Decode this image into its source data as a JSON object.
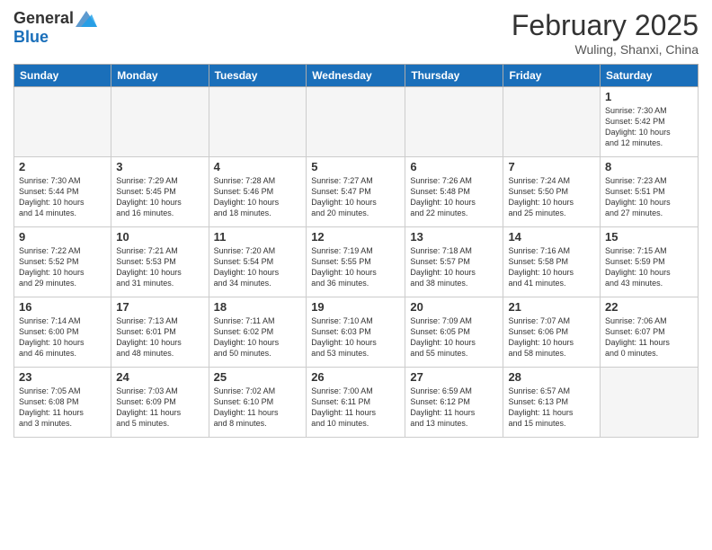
{
  "header": {
    "logo_general": "General",
    "logo_blue": "Blue",
    "month_title": "February 2025",
    "subtitle": "Wuling, Shanxi, China"
  },
  "days_of_week": [
    "Sunday",
    "Monday",
    "Tuesday",
    "Wednesday",
    "Thursday",
    "Friday",
    "Saturday"
  ],
  "weeks": [
    [
      {
        "num": "",
        "info": ""
      },
      {
        "num": "",
        "info": ""
      },
      {
        "num": "",
        "info": ""
      },
      {
        "num": "",
        "info": ""
      },
      {
        "num": "",
        "info": ""
      },
      {
        "num": "",
        "info": ""
      },
      {
        "num": "1",
        "info": "Sunrise: 7:30 AM\nSunset: 5:42 PM\nDaylight: 10 hours\nand 12 minutes."
      }
    ],
    [
      {
        "num": "2",
        "info": "Sunrise: 7:30 AM\nSunset: 5:44 PM\nDaylight: 10 hours\nand 14 minutes."
      },
      {
        "num": "3",
        "info": "Sunrise: 7:29 AM\nSunset: 5:45 PM\nDaylight: 10 hours\nand 16 minutes."
      },
      {
        "num": "4",
        "info": "Sunrise: 7:28 AM\nSunset: 5:46 PM\nDaylight: 10 hours\nand 18 minutes."
      },
      {
        "num": "5",
        "info": "Sunrise: 7:27 AM\nSunset: 5:47 PM\nDaylight: 10 hours\nand 20 minutes."
      },
      {
        "num": "6",
        "info": "Sunrise: 7:26 AM\nSunset: 5:48 PM\nDaylight: 10 hours\nand 22 minutes."
      },
      {
        "num": "7",
        "info": "Sunrise: 7:24 AM\nSunset: 5:50 PM\nDaylight: 10 hours\nand 25 minutes."
      },
      {
        "num": "8",
        "info": "Sunrise: 7:23 AM\nSunset: 5:51 PM\nDaylight: 10 hours\nand 27 minutes."
      }
    ],
    [
      {
        "num": "9",
        "info": "Sunrise: 7:22 AM\nSunset: 5:52 PM\nDaylight: 10 hours\nand 29 minutes."
      },
      {
        "num": "10",
        "info": "Sunrise: 7:21 AM\nSunset: 5:53 PM\nDaylight: 10 hours\nand 31 minutes."
      },
      {
        "num": "11",
        "info": "Sunrise: 7:20 AM\nSunset: 5:54 PM\nDaylight: 10 hours\nand 34 minutes."
      },
      {
        "num": "12",
        "info": "Sunrise: 7:19 AM\nSunset: 5:55 PM\nDaylight: 10 hours\nand 36 minutes."
      },
      {
        "num": "13",
        "info": "Sunrise: 7:18 AM\nSunset: 5:57 PM\nDaylight: 10 hours\nand 38 minutes."
      },
      {
        "num": "14",
        "info": "Sunrise: 7:16 AM\nSunset: 5:58 PM\nDaylight: 10 hours\nand 41 minutes."
      },
      {
        "num": "15",
        "info": "Sunrise: 7:15 AM\nSunset: 5:59 PM\nDaylight: 10 hours\nand 43 minutes."
      }
    ],
    [
      {
        "num": "16",
        "info": "Sunrise: 7:14 AM\nSunset: 6:00 PM\nDaylight: 10 hours\nand 46 minutes."
      },
      {
        "num": "17",
        "info": "Sunrise: 7:13 AM\nSunset: 6:01 PM\nDaylight: 10 hours\nand 48 minutes."
      },
      {
        "num": "18",
        "info": "Sunrise: 7:11 AM\nSunset: 6:02 PM\nDaylight: 10 hours\nand 50 minutes."
      },
      {
        "num": "19",
        "info": "Sunrise: 7:10 AM\nSunset: 6:03 PM\nDaylight: 10 hours\nand 53 minutes."
      },
      {
        "num": "20",
        "info": "Sunrise: 7:09 AM\nSunset: 6:05 PM\nDaylight: 10 hours\nand 55 minutes."
      },
      {
        "num": "21",
        "info": "Sunrise: 7:07 AM\nSunset: 6:06 PM\nDaylight: 10 hours\nand 58 minutes."
      },
      {
        "num": "22",
        "info": "Sunrise: 7:06 AM\nSunset: 6:07 PM\nDaylight: 11 hours\nand 0 minutes."
      }
    ],
    [
      {
        "num": "23",
        "info": "Sunrise: 7:05 AM\nSunset: 6:08 PM\nDaylight: 11 hours\nand 3 minutes."
      },
      {
        "num": "24",
        "info": "Sunrise: 7:03 AM\nSunset: 6:09 PM\nDaylight: 11 hours\nand 5 minutes."
      },
      {
        "num": "25",
        "info": "Sunrise: 7:02 AM\nSunset: 6:10 PM\nDaylight: 11 hours\nand 8 minutes."
      },
      {
        "num": "26",
        "info": "Sunrise: 7:00 AM\nSunset: 6:11 PM\nDaylight: 11 hours\nand 10 minutes."
      },
      {
        "num": "27",
        "info": "Sunrise: 6:59 AM\nSunset: 6:12 PM\nDaylight: 11 hours\nand 13 minutes."
      },
      {
        "num": "28",
        "info": "Sunrise: 6:57 AM\nSunset: 6:13 PM\nDaylight: 11 hours\nand 15 minutes."
      },
      {
        "num": "",
        "info": ""
      }
    ]
  ]
}
